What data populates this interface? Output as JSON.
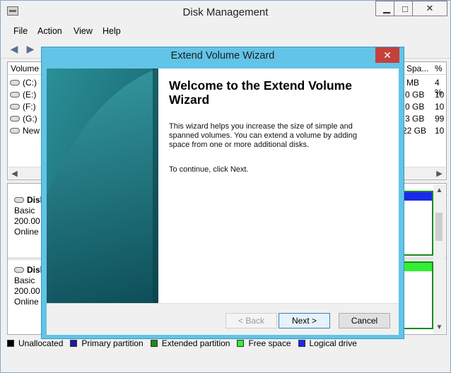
{
  "window": {
    "title": "Disk Management",
    "min_symbol": "▁",
    "max_symbol": "□",
    "close_symbol": "✕"
  },
  "menu": [
    "File",
    "Action",
    "View",
    "Help"
  ],
  "volume_list": {
    "headers": {
      "volume": "Volume",
      "space": "Spa...",
      "percent": "%"
    },
    "rows": [
      {
        "name": "(C:)",
        "space": "MB",
        "percent": "4 %"
      },
      {
        "name": "(E:)",
        "space": "0 GB",
        "percent": "10"
      },
      {
        "name": "(F:)",
        "space": "0 GB",
        "percent": "10"
      },
      {
        "name": "(G:)",
        "space": "3 GB",
        "percent": "99"
      },
      {
        "name": "New V",
        "space": "22 GB",
        "percent": "10"
      }
    ]
  },
  "disks": [
    {
      "name": "Disk",
      "type": "Basic",
      "size": "200.00 G",
      "status": "Online"
    },
    {
      "name": "Disk",
      "type": "Basic",
      "size": "200.00 G",
      "status": "Online"
    }
  ],
  "legend": [
    {
      "label": "Unallocated",
      "color": "#000000"
    },
    {
      "label": "Primary partition",
      "color": "#1b1b9c"
    },
    {
      "label": "Extended partition",
      "color": "#1a8a1a"
    },
    {
      "label": "Free space",
      "color": "#33ee33"
    },
    {
      "label": "Logical drive",
      "color": "#1a2ae8"
    }
  ],
  "wizard": {
    "title": "Extend Volume Wizard",
    "close_symbol": "✕",
    "heading": "Welcome to the Extend Volume Wizard",
    "description": "This wizard helps you increase the size of simple and spanned volumes. You can extend a volume  by adding space from one or more additional disks.",
    "continue_text": "To continue, click Next.",
    "buttons": {
      "back": "< Back",
      "next": "Next >",
      "cancel": "Cancel"
    }
  }
}
